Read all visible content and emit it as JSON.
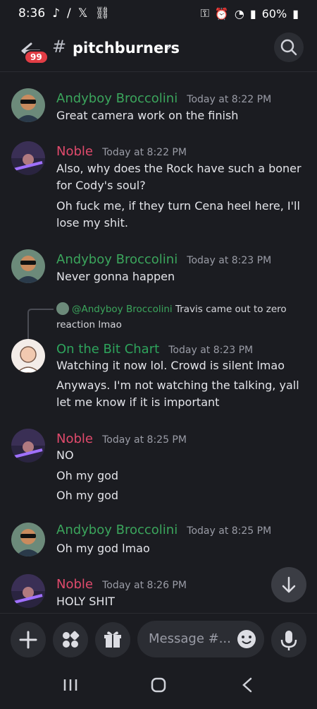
{
  "status_bar": {
    "time": "8:36",
    "battery": "60%",
    "icons_left": [
      "tiktok-icon",
      "slash-icon",
      "x-icon",
      "link-icon"
    ]
  },
  "header": {
    "unread_count": "99",
    "channel_name": "pitchburners"
  },
  "messages": [
    {
      "author": "Andyboy Broccolini",
      "time": "Today at 8:22 PM",
      "lines": [
        "Great camera work on the finish"
      ]
    },
    {
      "author": "Noble",
      "time": "Today at 8:22 PM",
      "lines": [
        "Also, why does the Rock have such a boner for Cody's soul?",
        "Oh fuck me, if they turn Cena heel here, I'll lose my shit."
      ]
    },
    {
      "author": "Andyboy Broccolini",
      "time": "Today at 8:23 PM",
      "lines": [
        "Never gonna happen"
      ]
    },
    {
      "reply_to": "@Andyboy Broccolini",
      "reply_text": " Travis came out to zero reaction lmao",
      "author": "On the Bit Chart",
      "time": "Today at 8:23 PM",
      "lines": [
        "Watching it now lol. Crowd is silent lmao",
        "Anyways. I'm not watching the talking, yall let me know if it is important"
      ]
    },
    {
      "author": "Noble",
      "time": "Today at 8:25 PM",
      "lines": [
        "NO",
        "Oh my god",
        "Oh my god"
      ]
    },
    {
      "author": "Andyboy Broccolini",
      "time": "Today at 8:25 PM",
      "lines": [
        "Oh my god lmao"
      ]
    },
    {
      "author": "Noble",
      "time": "Today at 8:26 PM",
      "lines": [
        "HOLY SHIT"
      ]
    }
  ],
  "composer": {
    "placeholder": "Message #..."
  },
  "colors": {
    "andyboy": "#3ba55c",
    "noble": "#e04a6c",
    "bitchart": "#2ea45c"
  }
}
